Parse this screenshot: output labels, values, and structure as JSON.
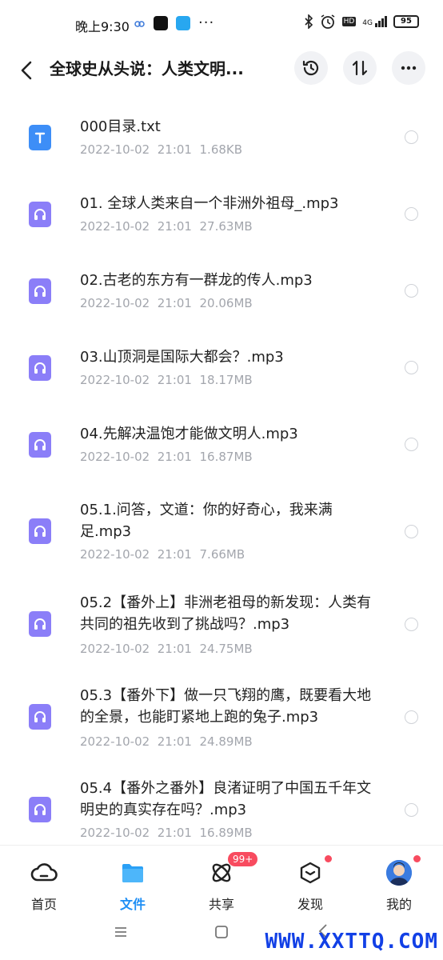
{
  "status": {
    "time": "晚上9:30",
    "network": "4G",
    "hd": "HD",
    "battery": "95"
  },
  "header": {
    "title": "全球史从头说：人类文明..."
  },
  "files": [
    {
      "type": "txt",
      "name": "000目录.txt",
      "date": "2022-10-02",
      "time": "21:01",
      "size": "1.68KB"
    },
    {
      "type": "mp3",
      "name": "01. 全球人类来自一个非洲外祖母_.mp3",
      "date": "2022-10-02",
      "time": "21:01",
      "size": "27.63MB"
    },
    {
      "type": "mp3",
      "name": "02.古老的东方有一群龙的传人.mp3",
      "date": "2022-10-02",
      "time": "21:01",
      "size": "20.06MB"
    },
    {
      "type": "mp3",
      "name": "03.山顶洞是国际大都会？.mp3",
      "date": "2022-10-02",
      "time": "21:01",
      "size": "18.17MB"
    },
    {
      "type": "mp3",
      "name": "04.先解决温饱才能做文明人.mp3",
      "date": "2022-10-02",
      "time": "21:01",
      "size": "16.87MB"
    },
    {
      "type": "mp3",
      "name": "05.1.问答，文道：你的好奇心，我来满足.mp3",
      "date": "2022-10-02",
      "time": "21:01",
      "size": "7.66MB"
    },
    {
      "type": "mp3",
      "name": "05.2【番外上】非洲老祖母的新发现：人类有共同的祖先收到了挑战吗？.mp3",
      "date": "2022-10-02",
      "time": "21:01",
      "size": "24.75MB"
    },
    {
      "type": "mp3",
      "name": "05.3【番外下】做一只飞翔的鹰，既要看大地的全景，也能盯紧地上跑的兔子.mp3",
      "date": "2022-10-02",
      "time": "21:01",
      "size": "24.89MB"
    },
    {
      "type": "mp3",
      "name": "05.4【番外之番外】良渚证明了中国五千年文明史的真实存在吗？.mp3",
      "date": "2022-10-02",
      "time": "21:01",
      "size": "16.89MB"
    }
  ],
  "nav": {
    "home": "首页",
    "files": "文件",
    "share": "共享",
    "share_badge": "99+",
    "discover": "发现",
    "mine": "我的"
  },
  "watermark": "WWW.XXTTQ.COM",
  "colors": {
    "accent": "#1d8ef5",
    "txt_icon": "#3d8ef7",
    "mp3_icon": "#8b7ef8",
    "badge": "#f84b5f",
    "meta_text": "#a3a6ad"
  }
}
